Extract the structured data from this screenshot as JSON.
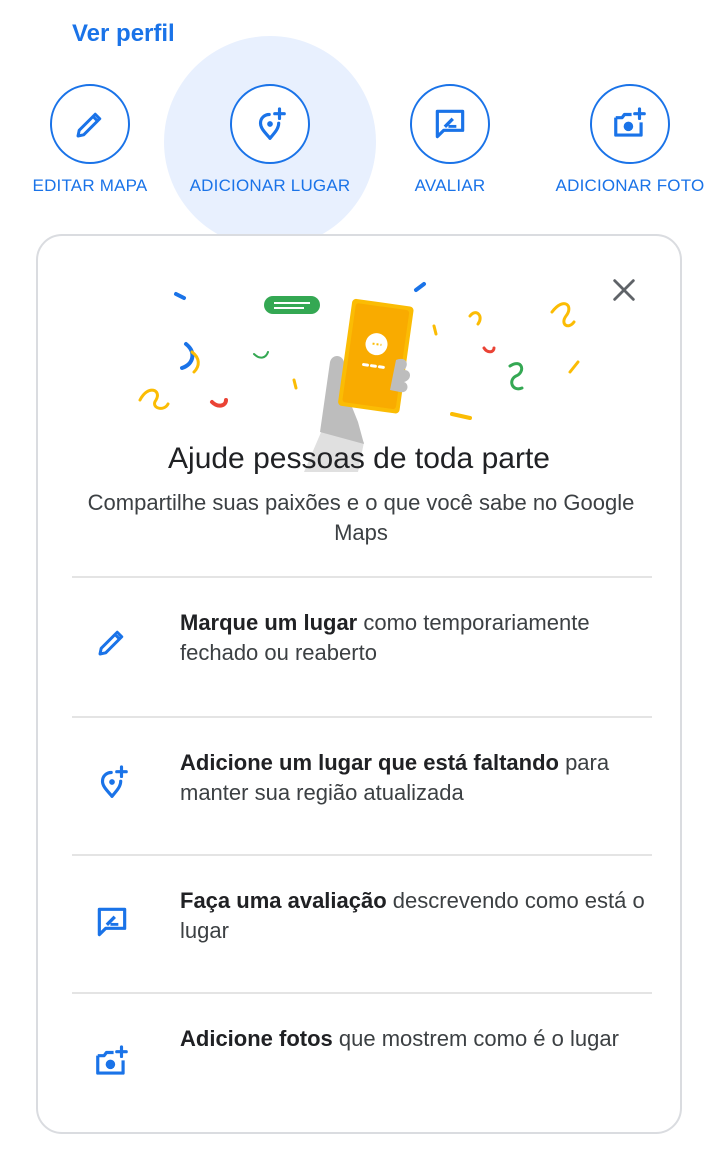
{
  "profile_link": "Ver perfil",
  "actions": [
    {
      "label": "EDITAR MAPA",
      "icon": "pencil-icon"
    },
    {
      "label": "ADICIONAR LUGAR",
      "icon": "add-place-icon"
    },
    {
      "label": "AVALIAR",
      "icon": "review-icon"
    },
    {
      "label": "ADICIONAR FOTO",
      "icon": "add-photo-icon"
    }
  ],
  "card": {
    "title": "Ajude pessoas de toda parte",
    "subtitle": "Compartilhe suas paixões e o que você sabe no Google Maps",
    "features": [
      {
        "icon": "pencil-icon",
        "bold": "Marque um lugar",
        "rest": " como temporariamente fechado ou reaberto"
      },
      {
        "icon": "add-place-icon",
        "bold": "Adicione um lugar que está faltando",
        "rest": " para manter sua região atualizada"
      },
      {
        "icon": "review-icon",
        "bold": "Faça uma avaliação",
        "rest": " descrevendo como está o lugar"
      },
      {
        "icon": "add-photo-icon",
        "bold": "Adicione fotos",
        "rest": " que mostrem como é o lugar"
      }
    ]
  },
  "colors": {
    "accent": "#1a73e8",
    "highlight": "#e8f0fe",
    "border": "#dadce0"
  }
}
